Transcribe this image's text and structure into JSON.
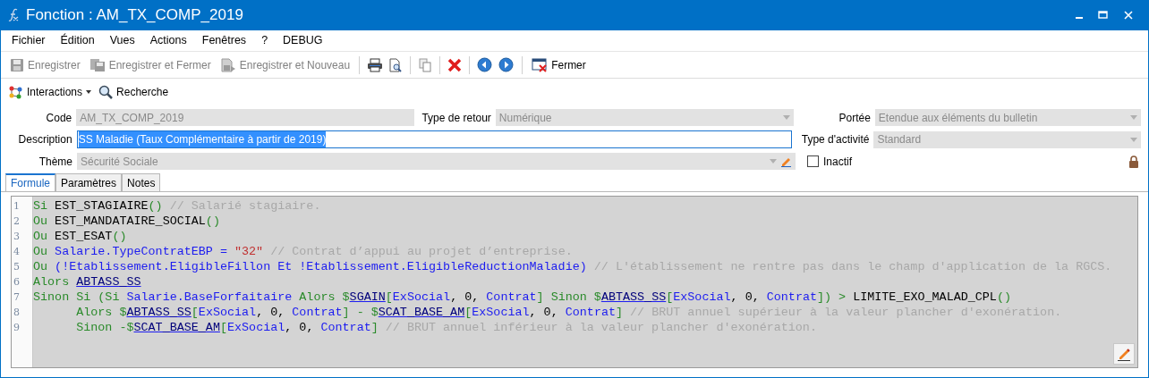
{
  "window": {
    "title": "Fonction : AM_TX_COMP_2019"
  },
  "menu": [
    "Fichier",
    "Édition",
    "Vues",
    "Actions",
    "Fenêtres",
    "?",
    "DEBUG"
  ],
  "toolbar": [
    {
      "label": "Enregistrer",
      "disabled": true
    },
    {
      "label": "Enregistrer et Fermer",
      "disabled": true
    },
    {
      "label": "Enregistrer et Nouveau",
      "disabled": true
    },
    {
      "label": "Fermer",
      "disabled": false
    }
  ],
  "toolbar2": {
    "interactions": "Interactions",
    "search": "Recherche"
  },
  "form": {
    "code": {
      "label": "Code",
      "value": "AM_TX_COMP_2019"
    },
    "return_type": {
      "label": "Type de retour",
      "value": "Numérique"
    },
    "scope": {
      "label": "Portée",
      "value": "Etendue aux éléments du bulletin"
    },
    "description": {
      "label": "Description",
      "value": "SS Maladie (Taux Complémentaire à partir de 2019)",
      "selected": true
    },
    "activity_type": {
      "label": "Type d'activité",
      "value": "Standard"
    },
    "theme": {
      "label": "Thème",
      "value": "Sécurité Sociale"
    },
    "inactive": {
      "label": "Inactif",
      "checked": false
    }
  },
  "tabs": [
    {
      "label": "Formule",
      "selected": true
    },
    {
      "label": "Paramètres",
      "selected": false
    },
    {
      "label": "Notes",
      "selected": false
    }
  ],
  "editor": {
    "lines": [
      {
        "number": "1",
        "tokens": [
          {
            "kind": "kw",
            "text": "Si "
          },
          {
            "kind": "fn",
            "text": "EST_STAGIAIRE"
          },
          {
            "kind": "kw",
            "text": "()"
          },
          {
            "kind": "cm",
            "text": " // Salarié stagiaire."
          }
        ]
      },
      {
        "number": "2",
        "tokens": [
          {
            "kind": "kw",
            "text": "Ou "
          },
          {
            "kind": "fn",
            "text": "EST_MANDATAIRE_SOCIAL"
          },
          {
            "kind": "kw",
            "text": "()"
          }
        ]
      },
      {
        "number": "3",
        "tokens": [
          {
            "kind": "kw",
            "text": "Ou "
          },
          {
            "kind": "fn",
            "text": "EST_ESAT"
          },
          {
            "kind": "kw",
            "text": "()"
          }
        ]
      },
      {
        "number": "4",
        "tokens": [
          {
            "kind": "kw",
            "text": "Ou "
          },
          {
            "kind": "id",
            "text": "Salarie.TypeContratEBP = "
          },
          {
            "kind": "str",
            "text": "\"32\""
          },
          {
            "kind": "cm",
            "text": " // Contrat d’appui au projet d’entreprise."
          }
        ]
      },
      {
        "number": "5",
        "tokens": [
          {
            "kind": "kw",
            "text": "Ou "
          },
          {
            "kind": "id",
            "text": "(!Etablissement.EligibleFillon Et !Etablissement.EligibleReductionMaladie)"
          },
          {
            "kind": "cm",
            "text": " // L'établissement ne rentre pas dans le champ d'application de la RGCS."
          }
        ]
      },
      {
        "number": "6",
        "tokens": [
          {
            "kind": "kw",
            "text": "Alors "
          },
          {
            "kind": "ref",
            "text": "ABTASS_SS"
          }
        ]
      },
      {
        "number": "7",
        "tokens": [
          {
            "kind": "kw",
            "text": "Sinon Si (Si "
          },
          {
            "kind": "id",
            "text": "Salarie.BaseForfaitaire"
          },
          {
            "kind": "kw",
            "text": " Alors $"
          },
          {
            "kind": "ref",
            "text": "SGAIN"
          },
          {
            "kind": "kw",
            "text": "["
          },
          {
            "kind": "id",
            "text": "ExSocial"
          },
          {
            "kind": "op",
            "text": ", 0, "
          },
          {
            "kind": "id",
            "text": "Contrat"
          },
          {
            "kind": "kw",
            "text": "] Sinon $"
          },
          {
            "kind": "ref",
            "text": "ABTASS_SS"
          },
          {
            "kind": "kw",
            "text": "["
          },
          {
            "kind": "id",
            "text": "ExSocial"
          },
          {
            "kind": "op",
            "text": ", 0, "
          },
          {
            "kind": "id",
            "text": "Contrat"
          },
          {
            "kind": "kw",
            "text": "]) > "
          },
          {
            "kind": "fn",
            "text": "LIMITE_EXO_MALAD_CPL"
          },
          {
            "kind": "kw",
            "text": "()"
          }
        ]
      },
      {
        "number": "8",
        "tokens": [
          {
            "kind": "kw",
            "text": "      Alors $"
          },
          {
            "kind": "ref",
            "text": "ABTASS_SS"
          },
          {
            "kind": "kw",
            "text": "["
          },
          {
            "kind": "id",
            "text": "ExSocial"
          },
          {
            "kind": "op",
            "text": ", 0, "
          },
          {
            "kind": "id",
            "text": "Contrat"
          },
          {
            "kind": "kw",
            "text": "] - $"
          },
          {
            "kind": "ref",
            "text": "SCAT_BASE_AM"
          },
          {
            "kind": "kw",
            "text": "["
          },
          {
            "kind": "id",
            "text": "ExSocial"
          },
          {
            "kind": "op",
            "text": ", 0, "
          },
          {
            "kind": "id",
            "text": "Contrat"
          },
          {
            "kind": "kw",
            "text": "]"
          },
          {
            "kind": "cm",
            "text": " // BRUT annuel supérieur à la valeur plancher d'exonération."
          }
        ]
      },
      {
        "number": "9",
        "tokens": [
          {
            "kind": "kw",
            "text": "      Sinon -$"
          },
          {
            "kind": "ref",
            "text": "SCAT_BASE_AM"
          },
          {
            "kind": "kw",
            "text": "["
          },
          {
            "kind": "id",
            "text": "ExSocial"
          },
          {
            "kind": "op",
            "text": ", 0, "
          },
          {
            "kind": "id",
            "text": "Contrat"
          },
          {
            "kind": "kw",
            "text": "]"
          },
          {
            "kind": "cm",
            "text": " // BRUT annuel inférieur à la valeur plancher d'exonération."
          }
        ]
      }
    ]
  }
}
